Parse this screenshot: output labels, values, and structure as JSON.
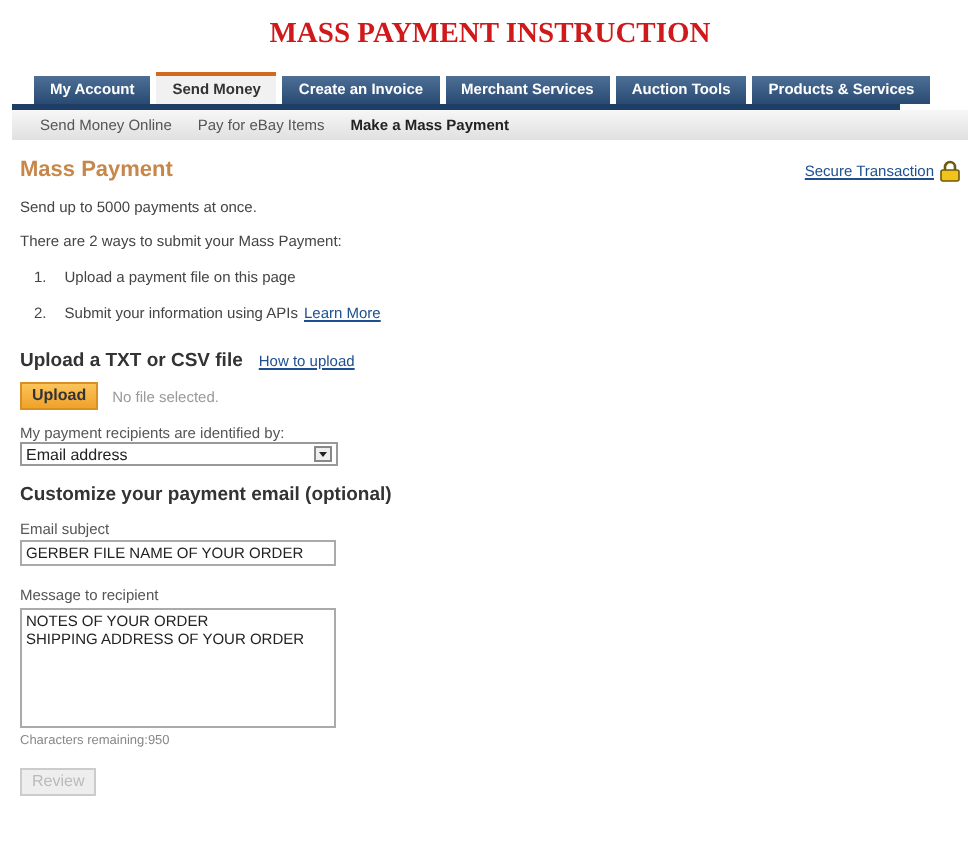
{
  "page_title": "MASS PAYMENT INSTRUCTION",
  "tabs": [
    {
      "label": "My Account",
      "selected": false
    },
    {
      "label": "Send Money",
      "selected": true
    },
    {
      "label": "Create an Invoice",
      "selected": false
    },
    {
      "label": "Merchant Services",
      "selected": false
    },
    {
      "label": "Auction Tools",
      "selected": false
    },
    {
      "label": "Products & Services",
      "selected": false
    }
  ],
  "subnav": [
    {
      "label": "Send Money Online",
      "selected": false
    },
    {
      "label": "Pay for eBay Items",
      "selected": false
    },
    {
      "label": "Make a Mass Payment",
      "selected": true
    }
  ],
  "heading": "Mass Payment",
  "secure_link": "Secure Transaction",
  "intro": "Send up to 5000 payments at once.",
  "ways_text": "There are 2 ways to submit your Mass Payment:",
  "ways": [
    {
      "number": "1.",
      "text": "Upload a payment file on this page"
    },
    {
      "number": "2.",
      "text": "Submit your information using APIs",
      "link": "Learn More"
    }
  ],
  "upload_heading": "Upload a TXT or CSV file",
  "upload_link": "How to upload",
  "upload_button": "Upload",
  "file_status": "No file selected.",
  "recipients_label": "My payment recipients are identified by:",
  "recipients_select": "Email address",
  "customize_heading": "Customize your payment email (optional)",
  "subject_label": "Email subject",
  "subject_value": "GERBER FILE NAME OF YOUR ORDER",
  "message_label": "Message to recipient",
  "message_value": "NOTES OF YOUR ORDER\nSHIPPING ADDRESS OF YOUR ORDER",
  "chars_remaining": "Characters remaining:950",
  "review_button": {
    "label": "Review",
    "disabled": true
  }
}
